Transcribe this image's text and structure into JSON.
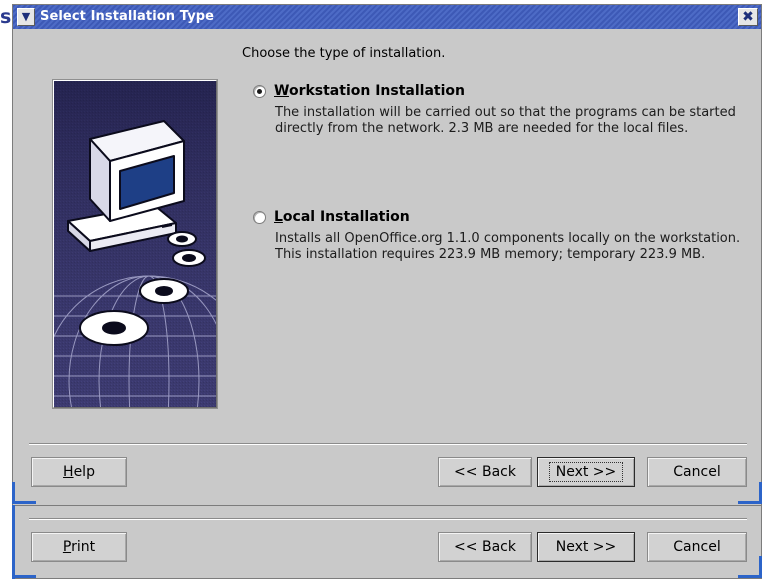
{
  "background": {
    "partial_text": "s"
  },
  "dialog": {
    "title": "Select Installation Type",
    "menu_glyph": "▼",
    "close_glyph": "✖",
    "instruction": "Choose the type of installation.",
    "options": [
      {
        "label_initial": "W",
        "label_rest": "orkstation Installation",
        "selected": true,
        "description": "The installation will be carried out so that the programs can be started directly from the network. 2.3 MB are needed for the local files."
      },
      {
        "label_initial": "L",
        "label_rest": "ocal Installation",
        "selected": false,
        "description": "Installs all OpenOffice.org 1.1.0 components locally on the workstation. This installation requires 223.9 MB memory; temporary 223.9 MB."
      }
    ],
    "buttons": {
      "help": "Help",
      "help_mnemonic": "H",
      "back": "<< Back",
      "next": "Next >>",
      "cancel": "Cancel"
    }
  },
  "dialog2": {
    "buttons": {
      "print": "Print",
      "print_mnemonic": "P",
      "back": "<< Back",
      "next": "Next >>",
      "cancel": "Cancel"
    }
  },
  "colors": {
    "titlebar": "#3d59b6",
    "dialog_bg": "#c9c9c9",
    "focus_accent": "#2c64c9",
    "illustration_bg": "#2d2b5c"
  },
  "icons": {
    "menu": "chevron-down-icon",
    "close": "close-icon",
    "illustration": "computer-with-discs-illustration"
  }
}
